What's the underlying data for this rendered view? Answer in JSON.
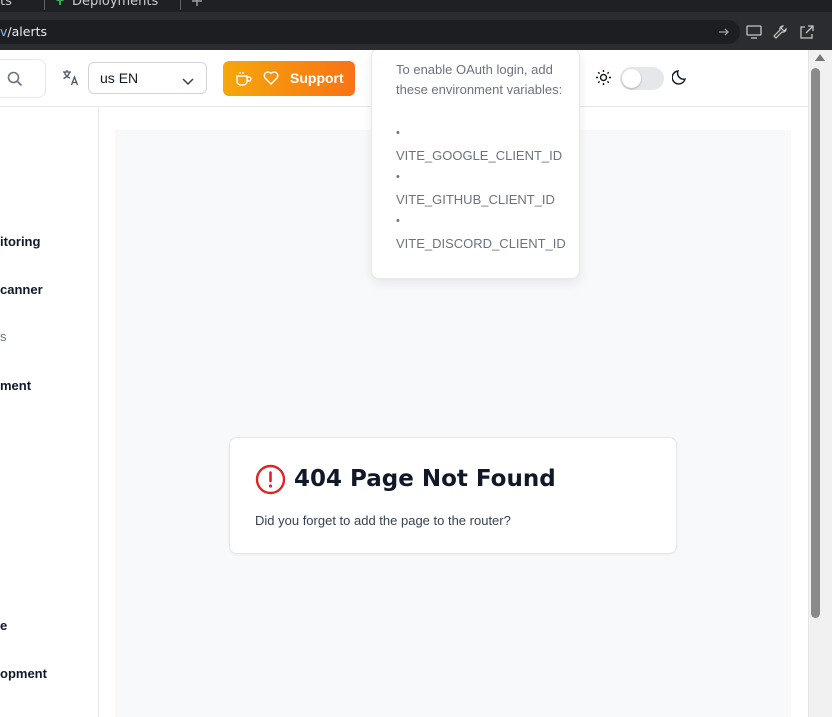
{
  "browser": {
    "tab_fragment_1": "ts",
    "tab_fragment_2": "Deployments",
    "url_host_tail": "v",
    "url_path": "/alerts"
  },
  "header": {
    "language_code": "us",
    "language": "EN",
    "support_label": "Support"
  },
  "sidebar": {
    "items": [
      "itoring",
      "canner",
      "s",
      "ment",
      "e",
      "opment"
    ]
  },
  "oauth_popover": {
    "intro": "To enable OAuth login, add these environment variables:",
    "bullet": "•",
    "variables": [
      "VITE_GOOGLE_CLIENT_ID",
      "VITE_GITHUB_CLIENT_ID",
      "VITE_DISCORD_CLIENT_ID"
    ]
  },
  "not_found": {
    "title": "404 Page Not Found",
    "message": "Did you forget to add the page to the router?"
  },
  "colors": {
    "support_gradient_start": "#f5a70b",
    "support_gradient_end": "#f97316",
    "error_icon": "#dc2626"
  },
  "icons": {
    "search": "search-icon",
    "translate": "translate-icon",
    "chevron": "chevron-down-icon",
    "coffee": "coffee-icon",
    "heart": "heart-icon",
    "sun": "sun-icon",
    "moon": "moon-icon",
    "error": "alert-circle-icon"
  }
}
